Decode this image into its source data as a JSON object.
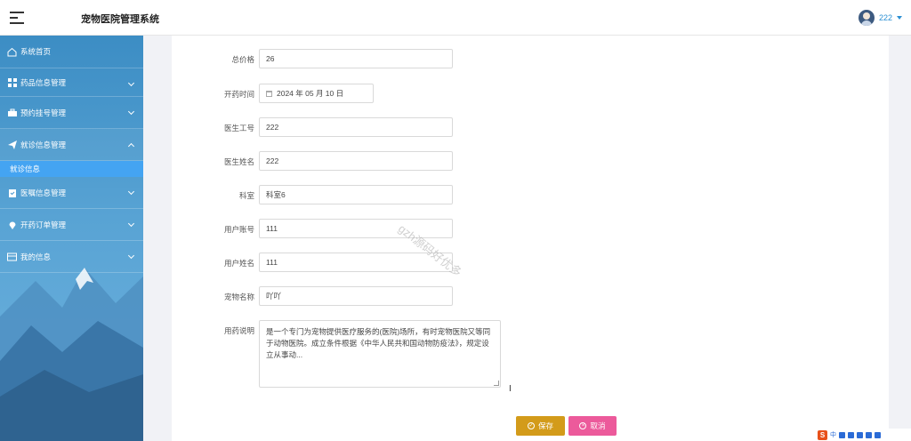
{
  "header": {
    "app_title": "宠物医院管理系统",
    "username": "222"
  },
  "sidebar": {
    "items": [
      {
        "label": "系统首页",
        "icon": "home-icon"
      },
      {
        "label": "药品信息管理",
        "icon": "grid-icon"
      },
      {
        "label": "预约挂号管理",
        "icon": "briefcase-icon"
      },
      {
        "label": "就诊信息管理",
        "icon": "paper-plane-icon"
      },
      {
        "label": "医嘱信息管理",
        "icon": "clipboard-icon"
      },
      {
        "label": "开药订单管理",
        "icon": "location-pin-icon"
      },
      {
        "label": "我的信息",
        "icon": "card-icon"
      }
    ],
    "sub_item": "就诊信息"
  },
  "form": {
    "total_price": {
      "label": "总价格",
      "value": "26"
    },
    "prescribe_time": {
      "label": "开药时间",
      "value": "2024 年 05 月 10 日"
    },
    "doctor_id": {
      "label": "医生工号",
      "value": "222"
    },
    "doctor_name": {
      "label": "医生姓名",
      "value": "222"
    },
    "department": {
      "label": "科室",
      "value": "科室6"
    },
    "user_account": {
      "label": "用户账号",
      "value": "111"
    },
    "user_name": {
      "label": "用户姓名",
      "value": "111"
    },
    "pet_name": {
      "label": "宠物名称",
      "value": "吖吖"
    },
    "usage_note": {
      "label": "用药说明",
      "value": "是一个专门为宠物提供医疗服务的(医院)场所，有时宠物医院又等同于动物医院。成立条件根据《中华人民共和国动物防疫法》，规定设立从事动..."
    }
  },
  "buttons": {
    "save": "保存",
    "cancel": "取消"
  },
  "watermark": "gzh源码好优多",
  "tray": {
    "lang": "中"
  }
}
